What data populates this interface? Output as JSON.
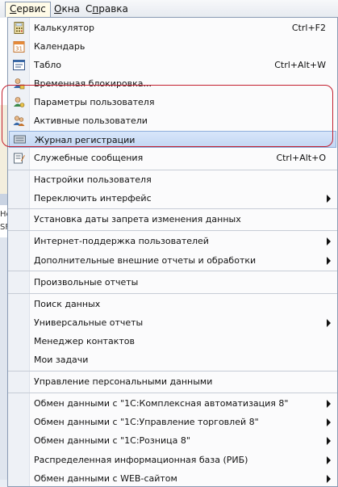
{
  "menubar": {
    "items": [
      {
        "label": "Сервис",
        "underline": "С",
        "rest": "ервис"
      },
      {
        "label": "Окна",
        "underline": "О",
        "rest": "кна"
      },
      {
        "label": "Справка",
        "underline": "п",
        "prefix": "С",
        "rest": "равка"
      }
    ]
  },
  "background": {
    "fragment1": "Но",
    "fragment2": "SF"
  },
  "menu": {
    "group1": [
      {
        "label": "Калькулятор",
        "shortcut": "Ctrl+F2",
        "icon": "calculator-icon"
      },
      {
        "label": "Календарь",
        "shortcut": "",
        "icon": "calendar-icon"
      },
      {
        "label": "Табло",
        "shortcut": "Ctrl+Alt+W",
        "icon": "board-icon"
      },
      {
        "label": "Временная блокировка...",
        "shortcut": "",
        "icon": "lock-user-icon"
      },
      {
        "label": "Параметры пользователя",
        "shortcut": "",
        "icon": "user-settings-icon"
      },
      {
        "label": "Активные пользователи",
        "shortcut": "",
        "icon": "active-users-icon"
      },
      {
        "label": "Журнал регистрации",
        "shortcut": "",
        "icon": "journal-icon"
      },
      {
        "label": "Служебные сообщения",
        "shortcut": "Ctrl+Alt+O",
        "icon": "messages-icon"
      }
    ],
    "group2": [
      {
        "label": "Настройки пользователя",
        "submenu": false
      },
      {
        "label": "Переключить интерфейс",
        "submenu": true
      }
    ],
    "group3": [
      {
        "label": "Установка даты запрета изменения данных",
        "submenu": false
      }
    ],
    "group4": [
      {
        "label": "Интернет-поддержка пользователей",
        "submenu": true
      },
      {
        "label": "Дополнительные внешние отчеты и обработки",
        "submenu": true
      }
    ],
    "group5": [
      {
        "label": "Произвольные отчеты",
        "submenu": false
      }
    ],
    "group6": [
      {
        "label": "Поиск данных",
        "submenu": false
      },
      {
        "label": "Универсальные отчеты",
        "submenu": true
      },
      {
        "label": "Менеджер контактов",
        "submenu": false
      },
      {
        "label": "Мои задачи",
        "submenu": false
      }
    ],
    "group7": [
      {
        "label": "Управление персональными данными",
        "submenu": false
      }
    ],
    "group8": [
      {
        "label": "Обмен данными с \"1С:Комплексная автоматизация 8\"",
        "submenu": true
      },
      {
        "label": "Обмен данными с \"1С:Управление торговлей 8\"",
        "submenu": true
      },
      {
        "label": "Обмен данными с \"1С:Розница 8\"",
        "submenu": true
      },
      {
        "label": "Распределенная информационная база (РИБ)",
        "submenu": true
      },
      {
        "label": "Обмен данными с WEB-сайтом",
        "submenu": true
      }
    ]
  },
  "colors": {
    "highlight": "#c3d7f3",
    "annotation": "#c31f2e"
  }
}
